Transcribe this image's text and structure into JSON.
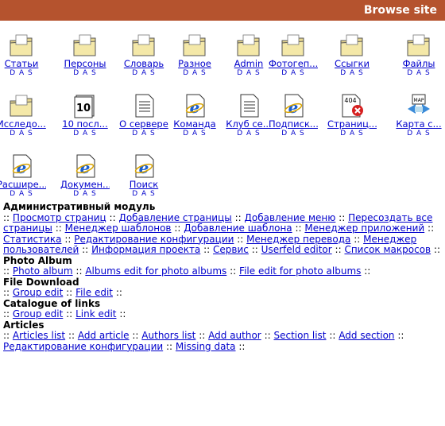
{
  "header": {
    "title": "Browse site"
  },
  "tiles": [
    {
      "label": "Статьи",
      "icon": "folder-icon",
      "das": "D A S",
      "col": 0,
      "row": 0
    },
    {
      "label": "Персоны",
      "icon": "folder-icon",
      "das": "D A S",
      "col": 1,
      "row": 0
    },
    {
      "label": "Словарь",
      "icon": "folder-icon",
      "das": "D A S",
      "col": 2,
      "row": 0
    },
    {
      "label": "Разное",
      "icon": "folder-icon",
      "das": "D A S",
      "col": 3,
      "row": 0
    },
    {
      "label": "Admin",
      "icon": "folder-icon",
      "das": "D A S",
      "col": 4,
      "row": 0
    },
    {
      "label": "Фотогеп...",
      "icon": "folder-icon",
      "das": "D A S",
      "col": 5,
      "row": 0
    },
    {
      "label": "Ссыгки",
      "icon": "folder-icon",
      "das": "D A S",
      "col": 6,
      "row": 0
    },
    {
      "label": "Файлы",
      "icon": "folder-icon",
      "das": "D A S",
      "col": 7,
      "row": 0
    },
    {
      "label": "Исследо...",
      "icon": "folder-icon",
      "das": "D A S",
      "col": 0,
      "row": 1
    },
    {
      "label": "10 посл...",
      "icon": "calendar-icon",
      "das": "D A S",
      "col": 1,
      "row": 1
    },
    {
      "label": "О сервере",
      "icon": "document-icon",
      "das": "D A S",
      "col": 2,
      "row": 1
    },
    {
      "label": "Команда",
      "icon": "ie-document-icon",
      "das": "D A S",
      "col": 3,
      "row": 1
    },
    {
      "label": "Клуб се...",
      "icon": "document-icon",
      "das": "D A S",
      "col": 4,
      "row": 1
    },
    {
      "label": "Подписк...",
      "icon": "ie-document-icon",
      "das": "D A S",
      "col": 5,
      "row": 1
    },
    {
      "label": "Страниц...",
      "icon": "error-404-icon",
      "das": "D A S",
      "col": 6,
      "row": 1
    },
    {
      "label": "Карта с...",
      "icon": "sitemap-icon",
      "das": "D A S",
      "col": 7,
      "row": 1
    },
    {
      "label": "Расшире...",
      "icon": "ie-document-icon",
      "das": "D A S",
      "col": 0,
      "row": 2
    },
    {
      "label": "Докумен...",
      "icon": "ie-document-icon",
      "das": "D A S",
      "col": 1,
      "row": 2
    },
    {
      "label": "Поиск",
      "icon": "ie-document-icon",
      "das": "D A S",
      "col": 2,
      "row": 2
    }
  ],
  "sections": [
    {
      "title": "Административный модуль",
      "links": [
        "Просмотр страниц",
        "Добавление страницы",
        "Добавление меню",
        "Пересоздать все страницы",
        "Менеджер шаблонов",
        "Добавление шаблона",
        "Менеджер приложений",
        "Статистика",
        "Редактирование конфигурации",
        "Менеджер перевода",
        "Менеджер пользователей",
        "Информация проекта",
        "Сервис",
        "Userfeld editor",
        "Список макросов"
      ]
    },
    {
      "title": "Photo Album",
      "links": [
        "Photo album",
        "Albums edit for photo albums",
        "File edit for photo albums"
      ]
    },
    {
      "title": "File Download",
      "links": [
        "Group edit",
        "File edit"
      ]
    },
    {
      "title": "Catalogue of links",
      "links": [
        "Group edit",
        "Link edit"
      ]
    },
    {
      "title": "Articles",
      "links": [
        "Articles list",
        "Add article",
        "Authors list",
        "Add author",
        "Section list",
        "Add section",
        "Редактирование конфигурации",
        "Missing data"
      ]
    }
  ],
  "separator": "::",
  "colors": {
    "header_bg": "#b5532e",
    "link": "#0000cc"
  }
}
